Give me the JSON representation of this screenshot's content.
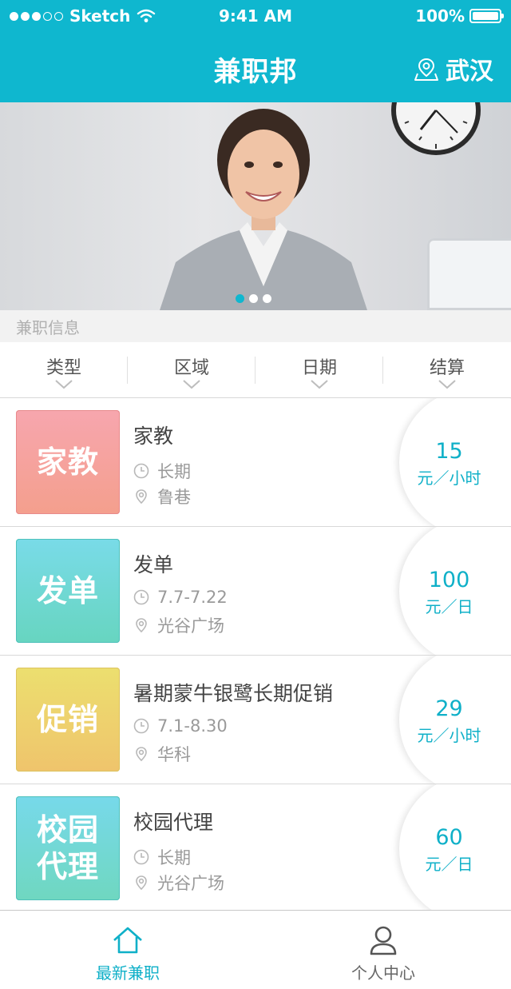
{
  "status_bar": {
    "carrier": "Sketch",
    "time": "9:41 AM",
    "battery": "100%"
  },
  "nav": {
    "title": "兼职邦",
    "city": "武汉",
    "city_icon": "location-icon"
  },
  "banner": {
    "active_slide": 1,
    "slide_count": 3
  },
  "section_label": "兼职信息",
  "filters": [
    {
      "label": "类型"
    },
    {
      "label": "区域"
    },
    {
      "label": "日期"
    },
    {
      "label": "结算"
    }
  ],
  "jobs": [
    {
      "tag": "家教",
      "tag_color": "#f5a3a3",
      "title": "家教",
      "time": "长期",
      "place": "鲁巷",
      "amount": "15",
      "unit": "元／小时"
    },
    {
      "tag": "发单",
      "tag_color": "#72d8d6",
      "title": "发单",
      "time": "7.7-7.22",
      "place": "光谷广场",
      "amount": "100",
      "unit": "元／日"
    },
    {
      "tag": "促销",
      "tag_color": "#ecd36c",
      "title": "暑期蒙牛银鹭长期促销",
      "time": "7.1-8.30",
      "place": "华科",
      "amount": "29",
      "unit": "元／小时"
    },
    {
      "tag": "校园代理",
      "tag_color": "#72d8d6",
      "title": "校园代理",
      "time": "长期",
      "place": "光谷广场",
      "amount": "60",
      "unit": "元／日"
    }
  ],
  "tabbar": {
    "home_label": "最新兼职",
    "profile_label": "个人中心"
  },
  "colors": {
    "accent": "#0fb7cf",
    "price": "#0fb0c8"
  }
}
